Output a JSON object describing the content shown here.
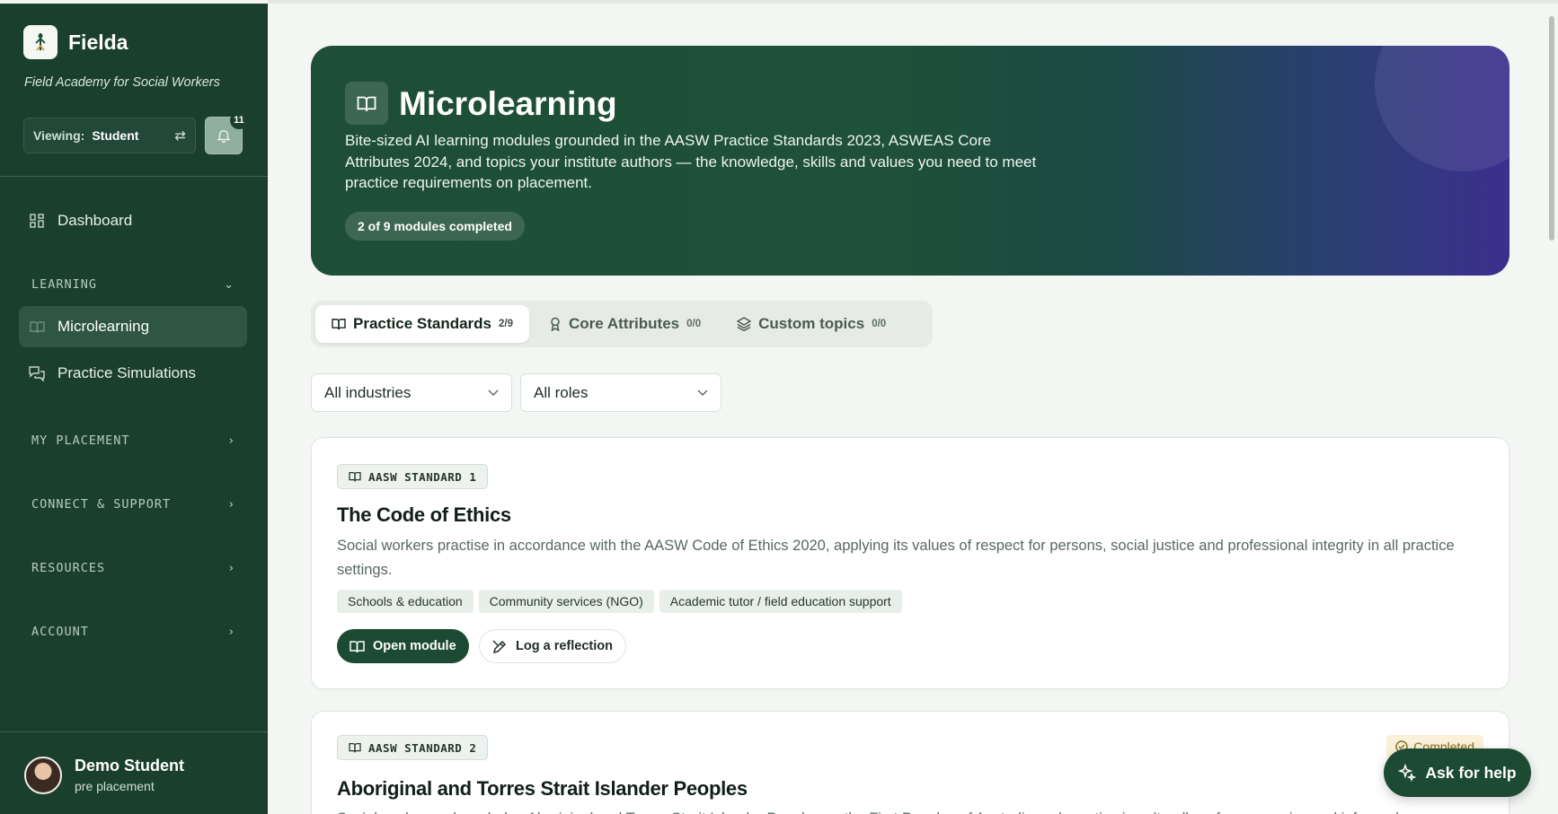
{
  "brand": {
    "name": "Fielda",
    "tagline": "Field Academy for Social Workers"
  },
  "viewing": {
    "label": "Viewing:",
    "value": "Student"
  },
  "notifications": {
    "count": "11"
  },
  "nav": {
    "dashboard": "Dashboard",
    "learning_section": "LEARNING",
    "microlearning": "Microlearning",
    "practice_simulations": "Practice Simulations",
    "my_placement": "MY PLACEMENT",
    "connect_support": "CONNECT & SUPPORT",
    "resources": "RESOURCES",
    "account": "ACCOUNT"
  },
  "user": {
    "name": "Demo Student",
    "status": "pre placement"
  },
  "hero": {
    "title": "Microlearning",
    "description": "Bite-sized AI learning modules grounded in the AASW Practice Standards 2023, ASWEAS Core Attributes 2024, and topics your institute authors — the knowledge, skills and values you need to meet practice requirements on placement.",
    "progress_label": "2 of 9 modules completed",
    "modules_completed": 2,
    "modules_total": 9
  },
  "tabs": [
    {
      "label": "Practice Standards",
      "count": "2/9",
      "icon": "book-icon"
    },
    {
      "label": "Core Attributes",
      "count": "0/0",
      "icon": "award-icon"
    },
    {
      "label": "Custom topics",
      "count": "0/0",
      "icon": "layers-icon"
    }
  ],
  "filters": {
    "industry": "All industries",
    "role": "All roles"
  },
  "cards": [
    {
      "badge": "AASW STANDARD 1",
      "title": "The Code of Ethics",
      "description": "Social workers practise in accordance with the AASW Code of Ethics 2020, applying its values of respect for persons, social justice and professional integrity in all practice settings.",
      "tags": [
        "Schools & education",
        "Community services (NGO)",
        "Academic tutor / field education support"
      ],
      "open_label": "Open module",
      "reflect_label": "Log a reflection"
    },
    {
      "badge": "AASW STANDARD 2",
      "title": "Aboriginal and Torres Strait Islander Peoples",
      "description": "Social workers acknowledge Aboriginal and Torres Strait Islander Peoples as the First Peoples of Australia and practise in culturally safe, responsive and informed",
      "status": "Completed"
    }
  ],
  "help": {
    "label": "Ask for help"
  },
  "colors": {
    "sidebar": "#1b3f2d",
    "accent": "#1d4a33",
    "hero_end": "#3d2f8f"
  }
}
